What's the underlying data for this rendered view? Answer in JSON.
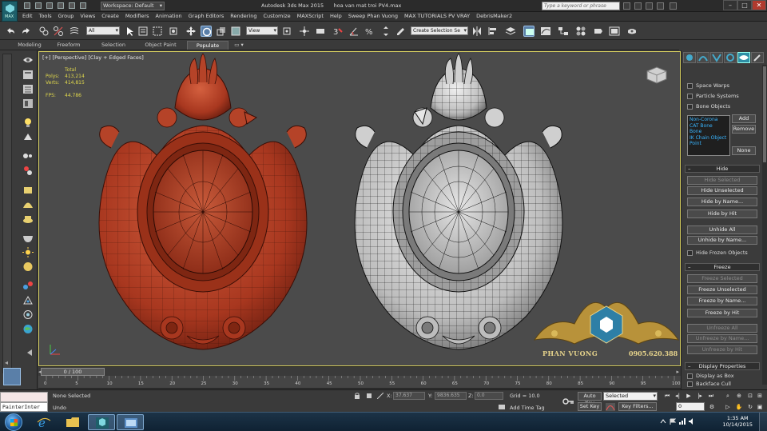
{
  "app": {
    "window_title": "Autodesk 3ds Max 2015",
    "document": "hoa van mat troi PV4.max",
    "workspace": "Workspace: Default",
    "search_placeholder": "Type a keyword or phrase",
    "logo_text": "MAX"
  },
  "menu": [
    "Edit",
    "Tools",
    "Group",
    "Views",
    "Create",
    "Modifiers",
    "Animation",
    "Graph Editors",
    "Rendering",
    "Customize",
    "MAXScript",
    "Help",
    "Sweep Phan Vuong",
    "MAX TUTORIALS PV VRAY",
    "DebrisMaker2"
  ],
  "toolbar": {
    "selection_filter": "All",
    "reference_coord": "View",
    "named_selection": "Create Selection Se",
    "icons": [
      "undo-icon",
      "redo-icon",
      "select-link-icon",
      "unlink-icon",
      "bind-spacewarp-icon",
      "select-object-icon",
      "select-by-name-icon",
      "rect-region-icon",
      "window-crossing-icon",
      "select-move-icon",
      "select-rotate-icon",
      "select-scale-icon",
      "pivot-icon",
      "snaps-icon",
      "angle-snap-icon",
      "percent-snap-icon",
      "spinner-snap-icon",
      "mirror-icon",
      "align-icon",
      "layer-icon",
      "graphite-icon",
      "curve-editor-icon",
      "schematic-icon",
      "material-editor-icon",
      "render-setup-icon",
      "rendered-frame-icon",
      "render-icon"
    ]
  },
  "ribbon": {
    "tabs": [
      "Modeling",
      "Freeform",
      "Selection",
      "Object Paint",
      "Populate"
    ],
    "active": "Populate"
  },
  "viewport": {
    "label": "[+] [Perspective] [Clay + Edged Faces]",
    "stats": {
      "header": "Total",
      "polys_label": "Polys:",
      "polys": "413,214",
      "verts_label": "Verts:",
      "verts": "414,815",
      "fps_label": "FPS:",
      "fps": "44.786"
    },
    "watermark": {
      "brand": "PHAN VUONG",
      "phone": "0905.620.388"
    },
    "models": [
      "red-clay-ornament",
      "white-wireframe-ornament"
    ],
    "colors": {
      "clay": "#b5402d",
      "white": "#c9c9c9",
      "wire": "#1a1a1a",
      "bg": "#4b4b4b",
      "frame": "#d6ce60"
    }
  },
  "command_panel": {
    "tabs": [
      "create-icon",
      "modify-icon",
      "hierarchy-icon",
      "motion-icon",
      "display-icon",
      "utilities-icon"
    ],
    "active_tab": "display-icon",
    "hide_by_category": [
      "Space Warps",
      "Particle Systems",
      "Bone Objects"
    ],
    "list_items": [
      "Non-Corona",
      "CAT Bone",
      "Bone",
      "IK Chain Object",
      "Point"
    ],
    "list_buttons": [
      "Add",
      "Remove",
      "None"
    ],
    "hide": {
      "title": "Hide",
      "buttons": [
        "Hide Selected",
        "Hide Unselected",
        "Hide by Name...",
        "Hide by Hit",
        "Unhide All",
        "Unhide by Name..."
      ],
      "checkbox": "Hide Frozen Objects"
    },
    "freeze": {
      "title": "Freeze",
      "buttons": [
        "Freeze Selected",
        "Freeze Unselected",
        "Freeze by Name...",
        "Freeze by Hit",
        "Unfreeze All",
        "Unfreeze by Name...",
        "Unfreeze by Hit"
      ]
    },
    "display_properties": {
      "title": "Display Properties",
      "items": [
        "Display as Box",
        "Backface Cull"
      ]
    }
  },
  "timeline": {
    "frame_display": "0 / 100",
    "ticks": [
      "0",
      "5",
      "10",
      "15",
      "20",
      "25",
      "30",
      "35",
      "40",
      "45",
      "50",
      "55",
      "60",
      "65",
      "70",
      "75",
      "80",
      "85",
      "90",
      "95",
      "100"
    ]
  },
  "status": {
    "script_listener": "PainterInter",
    "selection": "None Selected",
    "prompt": "Undo",
    "x_label": "X:",
    "x": "37.637",
    "y_label": "Y:",
    "y": "9836.635",
    "z_label": "Z:",
    "z": "0.0",
    "grid": "Grid = 10.0",
    "add_time_tag": "Add Time Tag",
    "auto_key": "Auto Key",
    "set_key": "Set Key",
    "key_mode": "Selected",
    "key_filters": "Key Filters...",
    "current_frame": "0"
  },
  "taskbar": {
    "time": "1:35 AM",
    "date": "10/14/2015",
    "apps": [
      "internet-explorer-icon",
      "file-explorer-icon",
      "3dsmax-icon",
      "image-viewer-icon"
    ]
  }
}
